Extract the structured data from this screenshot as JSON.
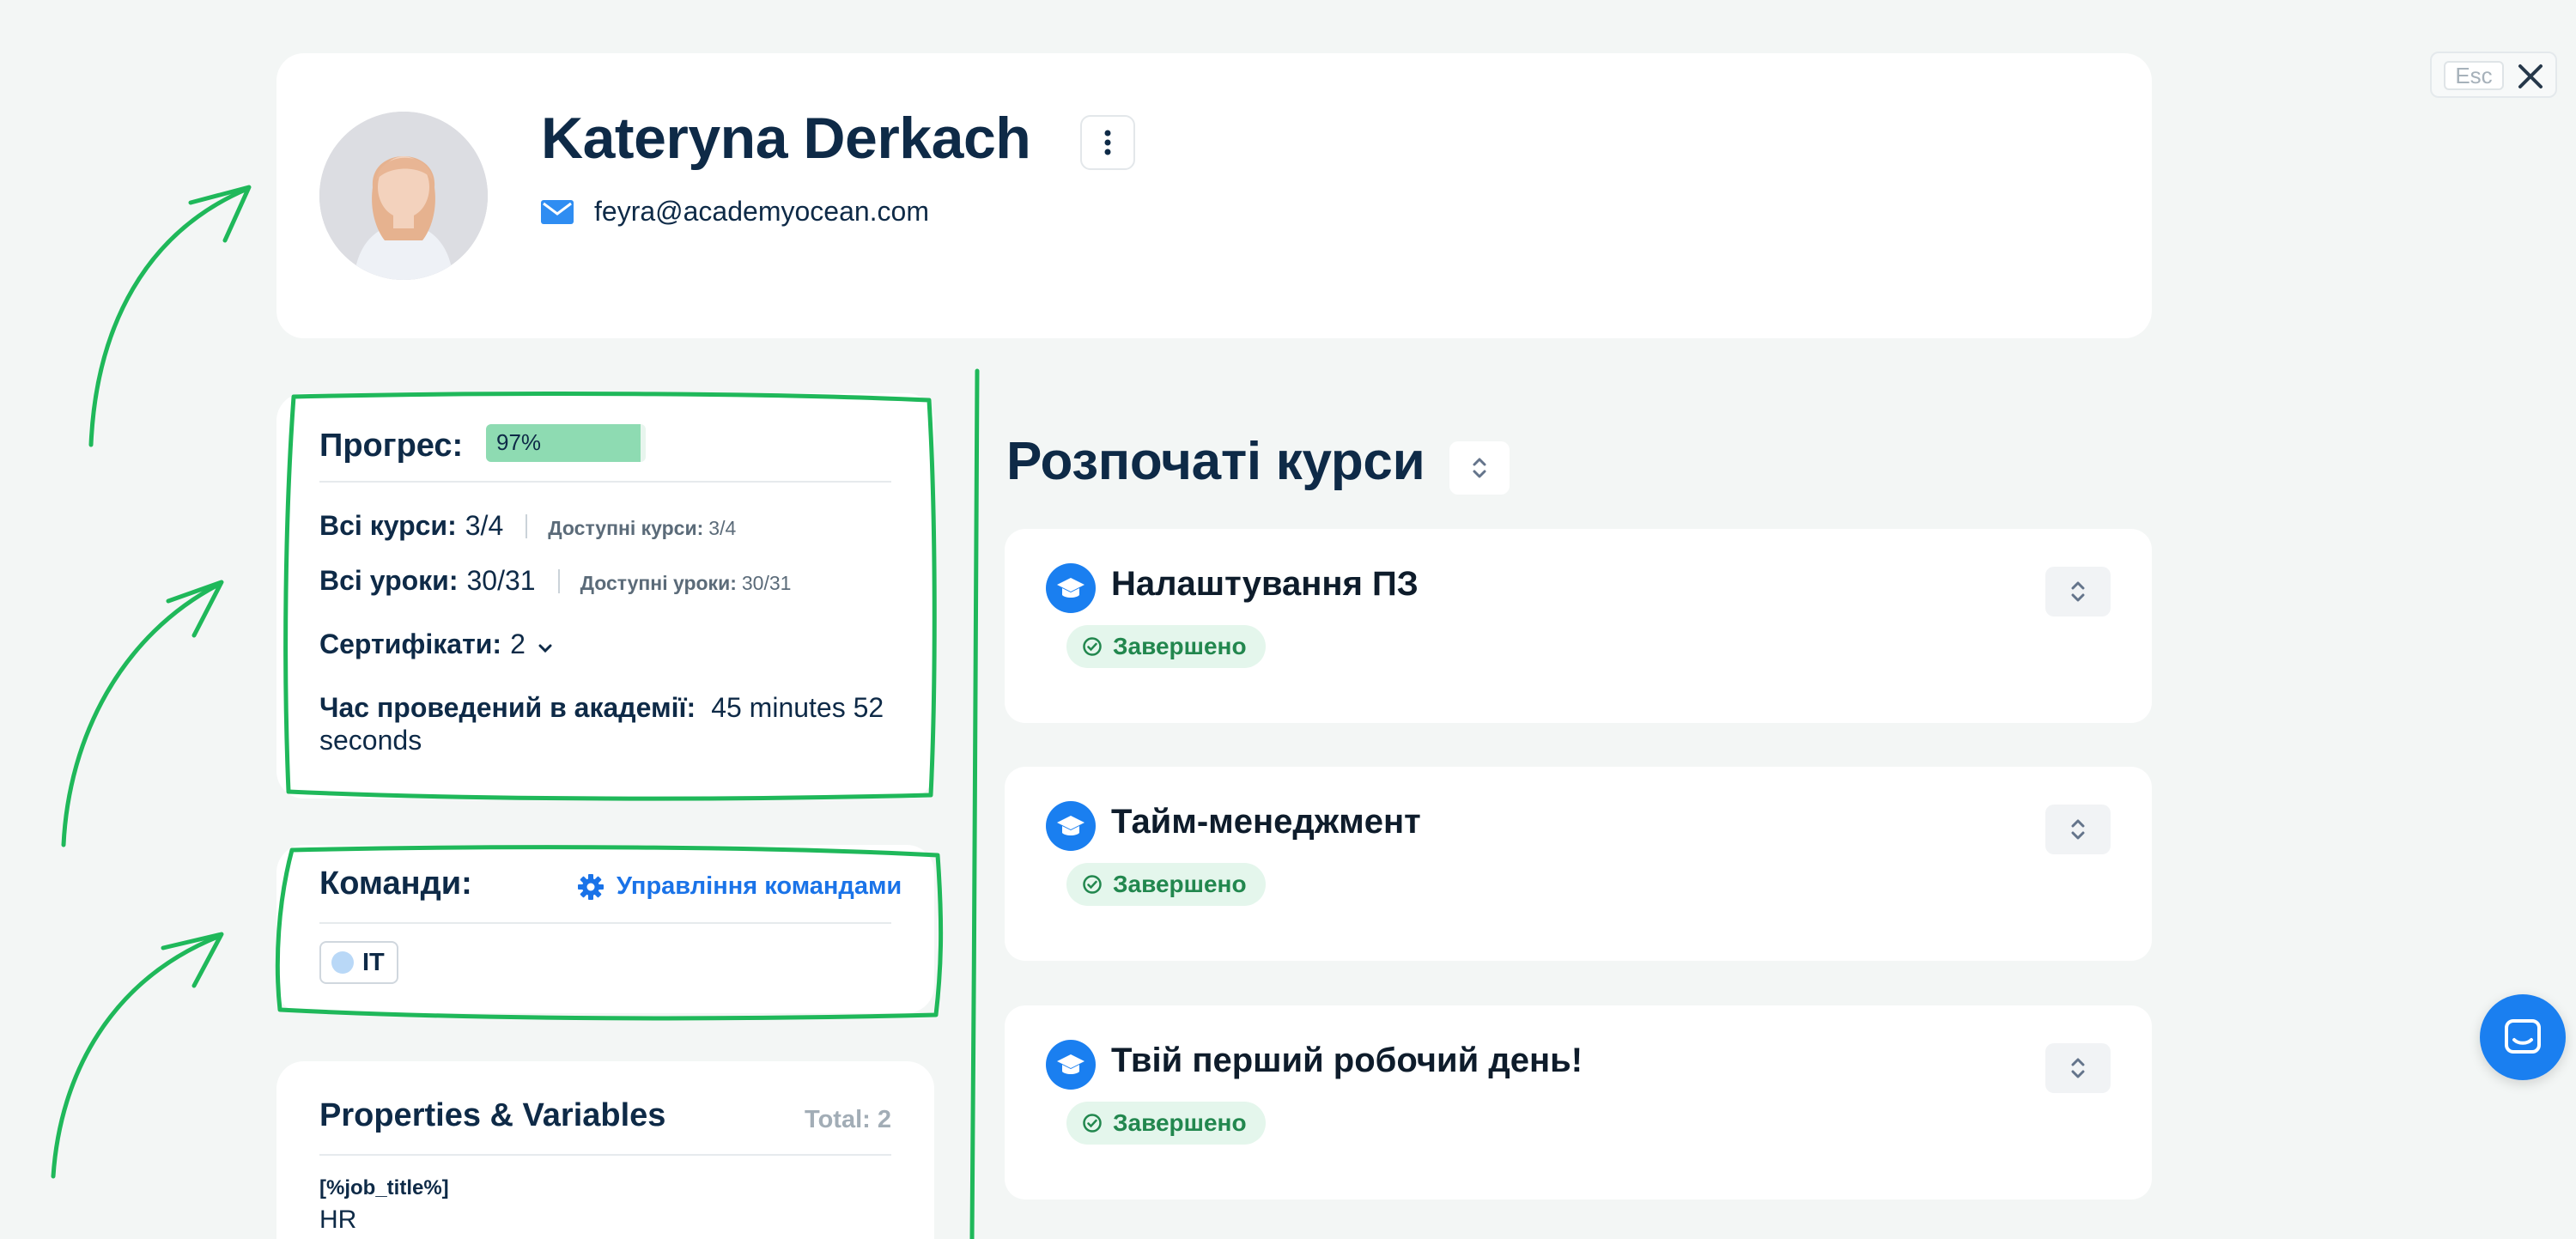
{
  "profile": {
    "name": "Kateryna Derkach",
    "email": "feyra@academyocean.com"
  },
  "esc": {
    "label": "Esc"
  },
  "progress": {
    "title": "Прогрес:",
    "percent_label": "97%",
    "percent": 97,
    "all_courses_label": "Всі курси:",
    "all_courses_value": "3/4",
    "available_courses_label": "Доступні курси:",
    "available_courses_value": "3/4",
    "all_lessons_label": "Всі уроки:",
    "all_lessons_value": "30/31",
    "available_lessons_label": "Доступні уроки:",
    "available_lessons_value": "30/31",
    "certificates_label": "Сертифікати:",
    "certificates_value": "2",
    "time_label": "Час проведений в академії:",
    "time_value": "45 minutes 52",
    "time_value_cont": "seconds"
  },
  "teams": {
    "title": "Команди:",
    "manage_label": "Управління командами",
    "items": [
      {
        "name": "IT"
      }
    ]
  },
  "properties": {
    "title": "Properties & Variables",
    "total_label": "Total: 2",
    "items": [
      {
        "key": "[%job_title%]",
        "value": "HR"
      }
    ]
  },
  "courses": {
    "heading": "Розпочаті курси",
    "items": [
      {
        "title": "Налаштування ПЗ",
        "status": "Завершено"
      },
      {
        "title": "Тайм-менеджмент",
        "status": "Завершено"
      },
      {
        "title": "Твій перший робочий день!",
        "status": "Завершено"
      }
    ]
  },
  "colors": {
    "accent": "#1a7ff0",
    "heading": "#0e2a47",
    "success_bg": "#e4f6ec",
    "success_text": "#22874e",
    "progress_fill": "#8edbb2",
    "annotation": "#1fb85a"
  },
  "icons": {
    "more": "more-vertical-icon",
    "email": "mail-icon",
    "close": "close-icon",
    "chevron": "chevron-down-icon",
    "gear": "gear-icon",
    "course": "graduation-cap-icon",
    "status": "check-circle-icon",
    "sort": "chevrons-up-down-icon",
    "chat": "chat-icon"
  }
}
